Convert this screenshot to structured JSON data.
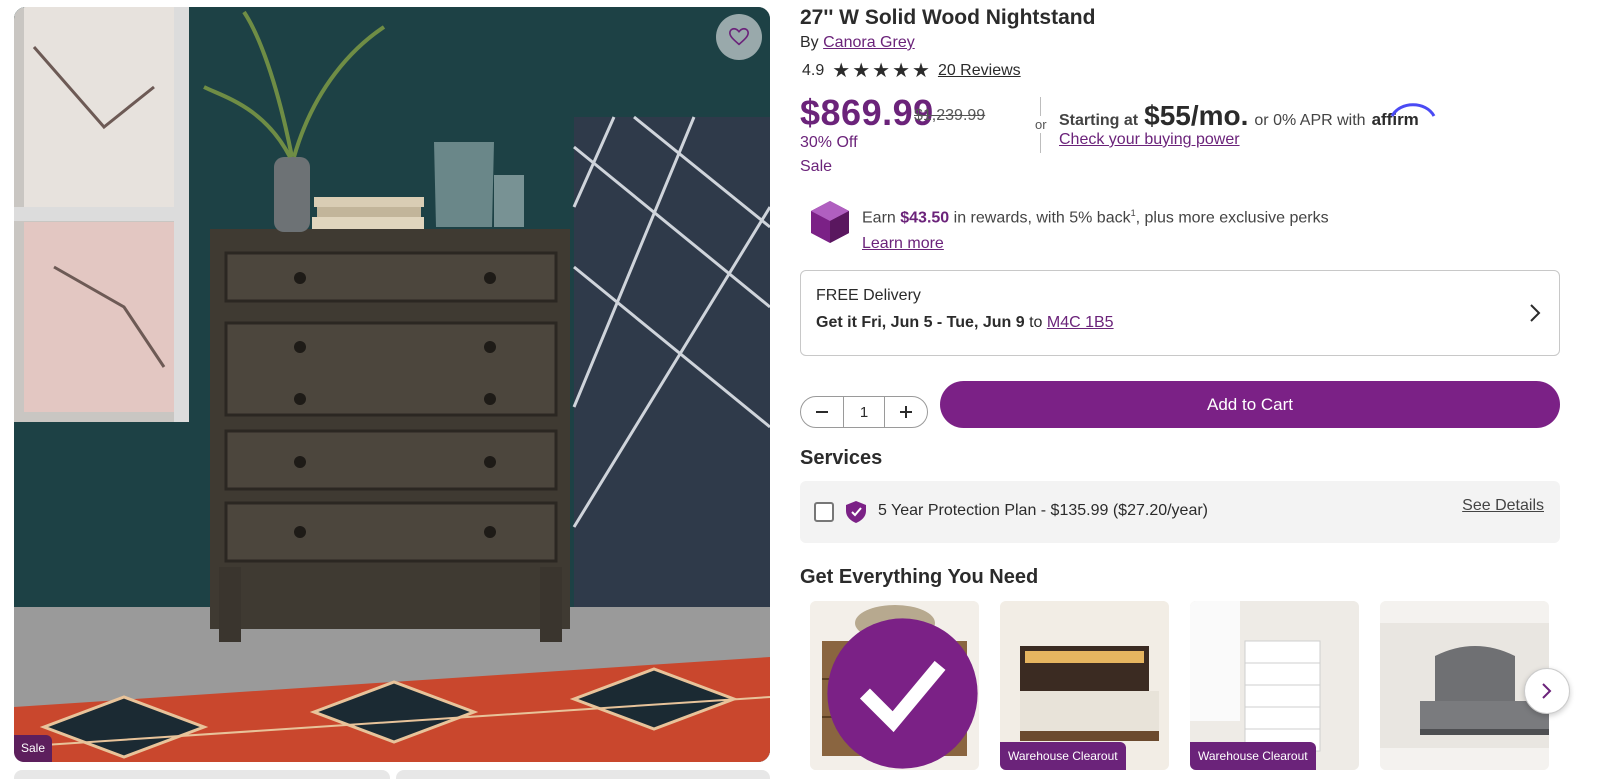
{
  "product": {
    "title": "27'' W Solid Wood Nightstand",
    "by_prefix": "By",
    "brand": "Canora Grey",
    "rating": "4.9",
    "reviews": "20 Reviews",
    "price": "$869.99",
    "was_price": "$1,239.99",
    "discount": "30% Off",
    "sale_label": "Sale",
    "image_sale_tag": "Sale"
  },
  "financing": {
    "or": "or",
    "starting_at": "Starting at",
    "monthly": "$55/mo.",
    "apr": "or 0% APR with",
    "provider": "affirm",
    "check_link": "Check your buying power"
  },
  "rewards": {
    "earn": "Earn",
    "amount": "$43.50",
    "text1": "in rewards, with 5% back",
    "sup": "1",
    "text2": ", plus more exclusive perks",
    "learn_more": "Learn more"
  },
  "delivery": {
    "free": "FREE Delivery",
    "get_it": "Get it Fri, Jun 5 - Tue, Jun 9",
    "to": "to",
    "postal": "M4C 1B5"
  },
  "quantity": {
    "value": "1"
  },
  "cart": {
    "label": "Add to Cart"
  },
  "services": {
    "heading": "Services",
    "plan": "5 Year Protection Plan - $135.99",
    "plan_per_year": "($27.20/year)",
    "see_details": "See Details"
  },
  "recommendations": {
    "heading": "Get Everything You Need",
    "items": [
      {
        "tag": ""
      },
      {
        "tag": "Warehouse Clearout"
      },
      {
        "tag": "Warehouse Clearout"
      },
      {
        "tag": ""
      }
    ]
  },
  "icons": {
    "favorite": "heart-icon",
    "rewards": "rewards-cube-icon",
    "delivery_chevron": "chevron-right-icon",
    "minus": "minus-icon",
    "plus": "plus-icon",
    "protection": "shield-icon",
    "carousel_next": "chevron-right-icon"
  },
  "colors": {
    "brand_purple": "#7b2186",
    "price_purple": "#6b237a"
  }
}
